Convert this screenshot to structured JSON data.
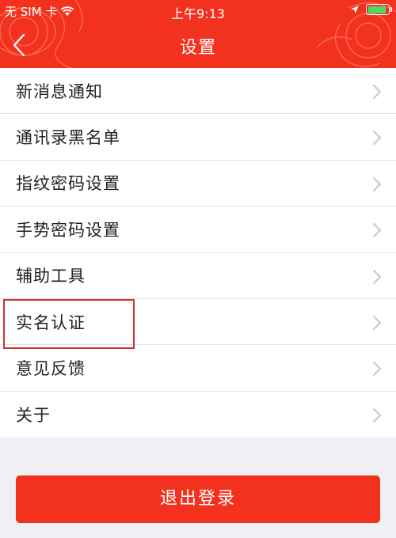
{
  "status_bar": {
    "carrier": "无 SIM 卡",
    "time": "上午9:13",
    "battery_color": "#4cd964",
    "battery_level": 0.9
  },
  "nav": {
    "title": "设置",
    "back_icon": "chevron-left-icon",
    "header_color": "#f2321f"
  },
  "menu": {
    "items": [
      {
        "label": "新消息通知"
      },
      {
        "label": "通讯录黑名单"
      },
      {
        "label": "指纹密码设置"
      },
      {
        "label": "手势密码设置"
      },
      {
        "label": "辅助工具"
      },
      {
        "label": "实名认证"
      },
      {
        "label": "意见反馈"
      },
      {
        "label": "关于"
      }
    ],
    "chevron_icon": "chevron-right-icon"
  },
  "highlight_color": "#d32f2f",
  "logout": {
    "label": "退出登录"
  }
}
